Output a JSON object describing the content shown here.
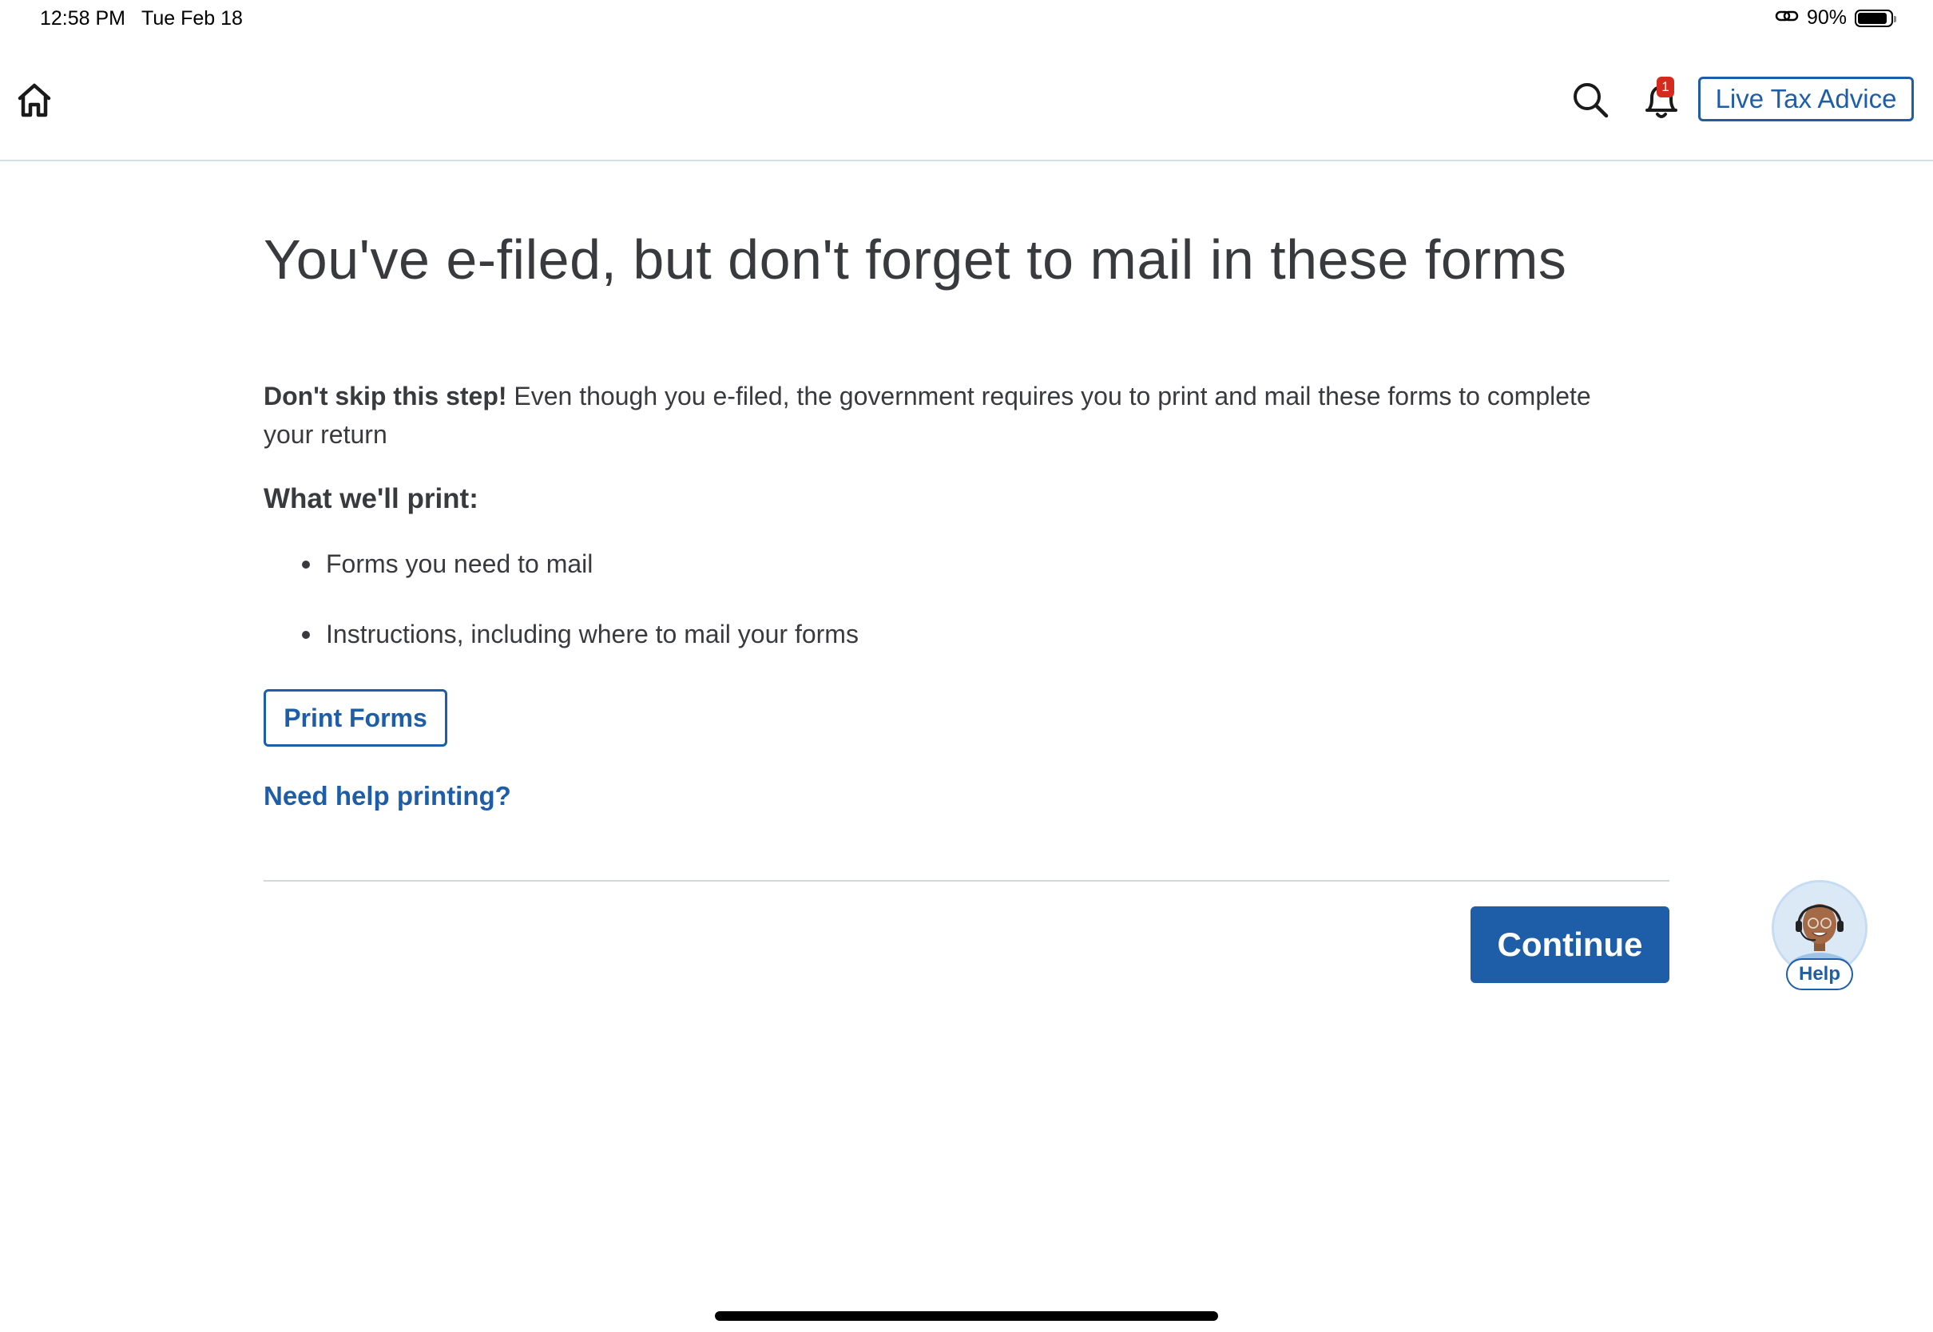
{
  "status_bar": {
    "time": "12:58 PM",
    "date": "Tue Feb 18",
    "battery_percent": "90%",
    "battery_level": 0.9
  },
  "header": {
    "icons": [
      "home-icon",
      "search-icon",
      "bell-icon"
    ],
    "notification_count": "1",
    "live_advice_label": "Live Tax Advice"
  },
  "main": {
    "title": "You've e-filed, but don't forget to mail in these forms",
    "intro_bold": "Don't skip this step!",
    "intro_text": " Even though you e-filed, the government requires you to print and mail these forms to complete your return",
    "subheading": "What we'll print:",
    "print_items": [
      "Forms you need to mail",
      "Instructions, including where to mail your forms"
    ],
    "print_button_label": "Print Forms",
    "help_link_label": "Need help printing?",
    "continue_label": "Continue"
  },
  "help_widget": {
    "label": "Help",
    "icon": "agent-avatar-icon"
  },
  "colors": {
    "accent": "#1e5ea8",
    "text": "#393a3d",
    "badge": "#d52b1e",
    "divider": "#d4d7dc"
  }
}
